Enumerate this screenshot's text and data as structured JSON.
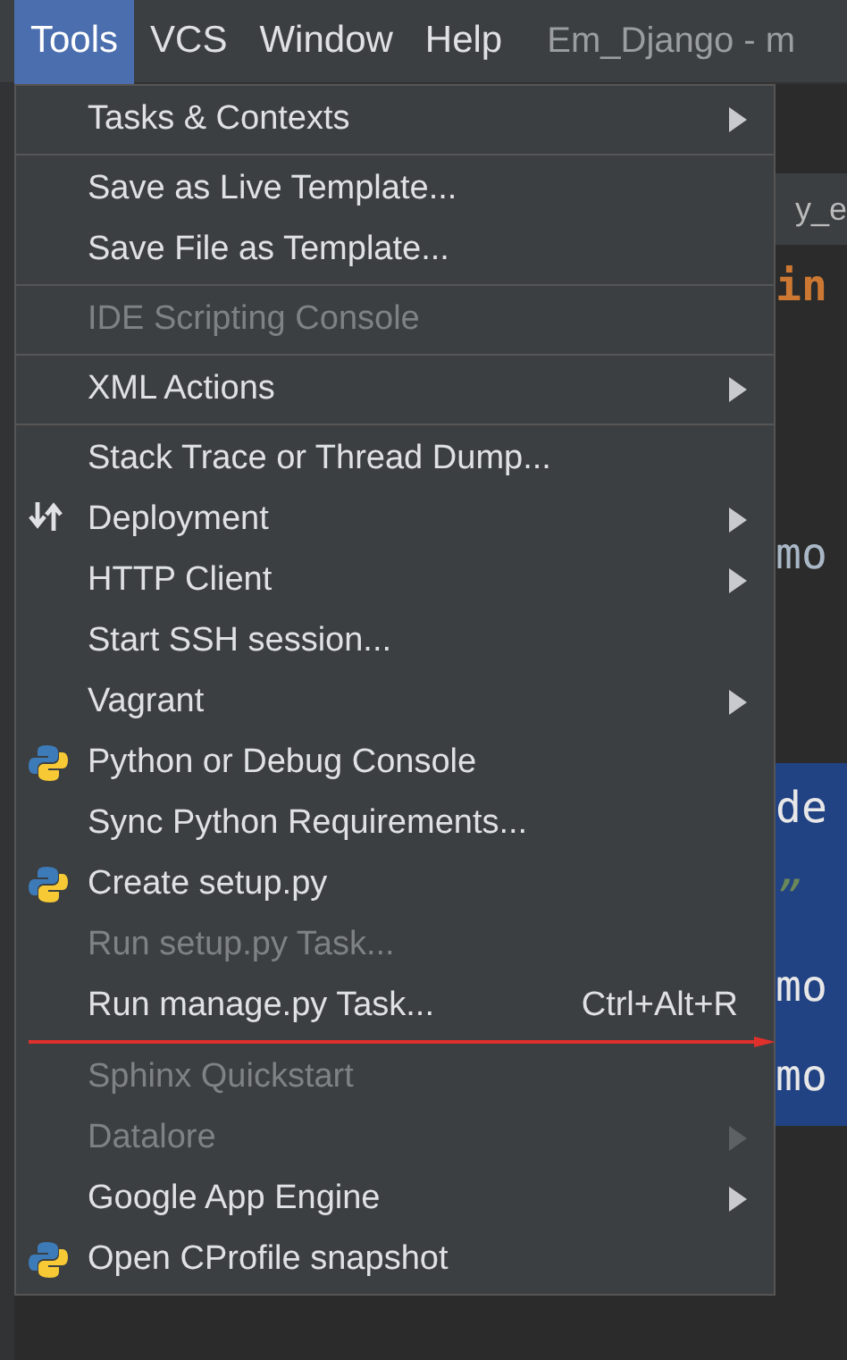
{
  "menubar": {
    "menus": [
      {
        "label": "Tools",
        "selected": true
      },
      {
        "label": "VCS",
        "selected": false
      },
      {
        "label": "Window",
        "selected": false
      },
      {
        "label": "Help",
        "selected": false
      }
    ],
    "title": "Em_Django - m"
  },
  "editor": {
    "tab_fragment": "y_e",
    "lines": [
      {
        "text": "in",
        "kind": "keyword"
      },
      {
        "text": "mo",
        "kind": "plain"
      },
      {
        "text": "de",
        "kind": "selected"
      },
      {
        "text": "”",
        "kind": "string"
      },
      {
        "text": "mo",
        "kind": "selected"
      },
      {
        "text": "mo",
        "kind": "selected"
      }
    ]
  },
  "menu": {
    "items": [
      {
        "kind": "item",
        "label": "Tasks & Contexts",
        "submenu": true,
        "disabled": false
      },
      {
        "kind": "separator"
      },
      {
        "kind": "item",
        "label": "Save as Live Template...",
        "submenu": false,
        "disabled": false
      },
      {
        "kind": "item",
        "label": "Save File as Template...",
        "submenu": false,
        "disabled": false
      },
      {
        "kind": "separator"
      },
      {
        "kind": "item",
        "label": "IDE Scripting Console",
        "submenu": false,
        "disabled": true
      },
      {
        "kind": "separator"
      },
      {
        "kind": "item",
        "label": "XML Actions",
        "submenu": true,
        "disabled": false
      },
      {
        "kind": "separator"
      },
      {
        "kind": "item",
        "label": "Stack Trace or Thread Dump...",
        "submenu": false,
        "disabled": false
      },
      {
        "kind": "deployment",
        "label": "Deployment",
        "submenu": true,
        "disabled": false
      },
      {
        "kind": "item",
        "label": "HTTP Client",
        "submenu": true,
        "disabled": false
      },
      {
        "kind": "item",
        "label": "Start SSH session...",
        "submenu": false,
        "disabled": false
      },
      {
        "kind": "item",
        "label": "Vagrant",
        "submenu": true,
        "disabled": false
      },
      {
        "kind": "python",
        "label": "Python or Debug Console",
        "submenu": false,
        "disabled": false
      },
      {
        "kind": "item",
        "label": "Sync Python Requirements...",
        "submenu": false,
        "disabled": false
      },
      {
        "kind": "python",
        "label": "Create setup.py",
        "submenu": false,
        "disabled": false
      },
      {
        "kind": "item",
        "label": "Run setup.py Task...",
        "submenu": false,
        "disabled": true
      },
      {
        "kind": "item",
        "label": "Run manage.py Task...",
        "submenu": false,
        "disabled": false,
        "shortcut": "Ctrl+Alt+R"
      },
      {
        "kind": "item",
        "label": "Sphinx Quickstart",
        "submenu": false,
        "disabled": true
      },
      {
        "kind": "item",
        "label": "Datalore",
        "submenu": true,
        "disabled": true
      },
      {
        "kind": "item",
        "label": "Google App Engine",
        "submenu": true,
        "disabled": false
      },
      {
        "kind": "python",
        "label": "Open CProfile snapshot",
        "submenu": false,
        "disabled": false
      }
    ]
  }
}
